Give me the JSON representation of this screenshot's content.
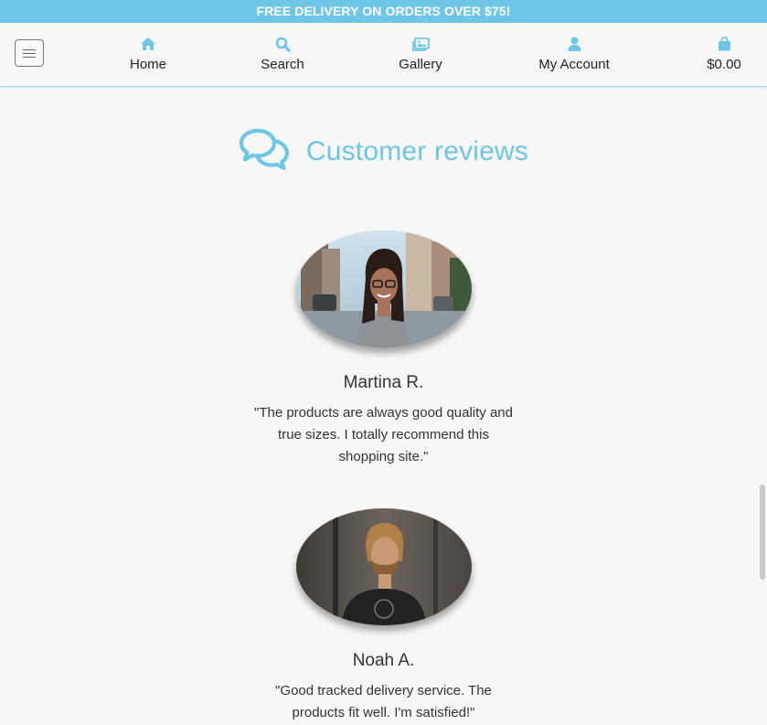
{
  "banner": {
    "text": "FREE DELIVERY ON ORDERS OVER $75!"
  },
  "nav": {
    "items": [
      {
        "label": "Home",
        "icon": "home-icon"
      },
      {
        "label": "Search",
        "icon": "search-icon"
      },
      {
        "label": "Gallery",
        "icon": "gallery-icon"
      },
      {
        "label": "My Account",
        "icon": "user-icon"
      },
      {
        "label": "$0.00",
        "icon": "shopping-bag-icon"
      }
    ]
  },
  "reviews_section": {
    "title": "Customer reviews",
    "icon": "comments-icon",
    "reviews": [
      {
        "name": "Martina R.",
        "quote": "\"The products are always good quality and true sizes. I totally recommend this shopping site.\""
      },
      {
        "name": "Noah A.",
        "quote": "\"Good tracked delivery service. The products fit well. I'm satisfied!\""
      }
    ]
  },
  "colors": {
    "accent": "#6ec6e6",
    "background": "#f7f7f7",
    "text": "#333333"
  }
}
